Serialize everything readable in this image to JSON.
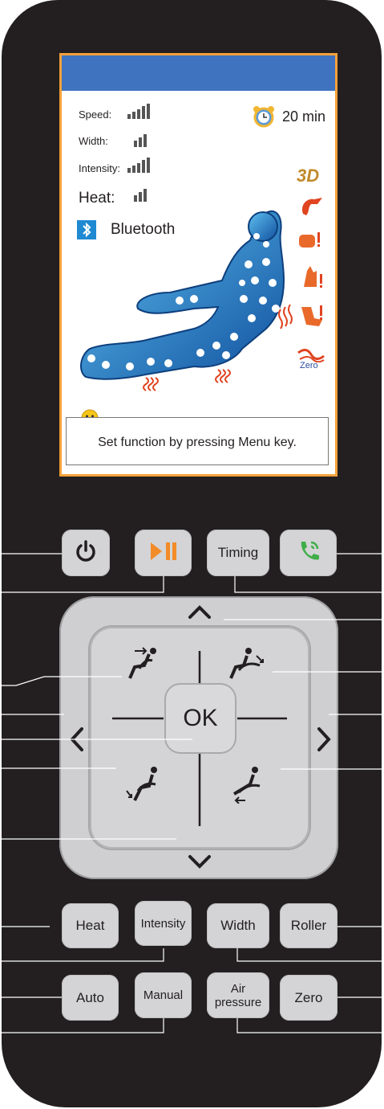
{
  "screen": {
    "speed_label": "Speed:",
    "width_label": "Width:",
    "intensity_label": "Intensity:",
    "heat_label": "Heat:",
    "timer_text": "20 min",
    "bluetooth_label": "Bluetooth",
    "mode_3d": "3D",
    "zero_label": "Zero",
    "message": "Set function by pressing Menu key.",
    "speed_level": 5,
    "width_level": 3,
    "intensity_level": 5,
    "heat_level": 3
  },
  "buttons": {
    "timing": "Timing",
    "ok": "OK",
    "heat": "Heat",
    "intensity": "Intensity",
    "width": "Width",
    "roller": "Roller",
    "auto": "Auto",
    "manual": "Manual",
    "air_pressure_line1": "Air",
    "air_pressure_line2": "pressure",
    "zero": "Zero"
  },
  "icons": {
    "power": "power-icon",
    "play_pause": "play-pause-icon",
    "phone": "phone-icon",
    "up": "chevron-up-icon",
    "down": "chevron-down-icon",
    "left": "chevron-left-icon",
    "right": "chevron-right-icon"
  },
  "colors": {
    "body": "#231f20",
    "button": "#d4d4d6",
    "screen_header": "#3f73c0",
    "accent_orange": "#f6a13a",
    "phone_green": "#3fae49",
    "bluetooth_blue": "#1f8ad2",
    "warning_red": "#e04420"
  }
}
